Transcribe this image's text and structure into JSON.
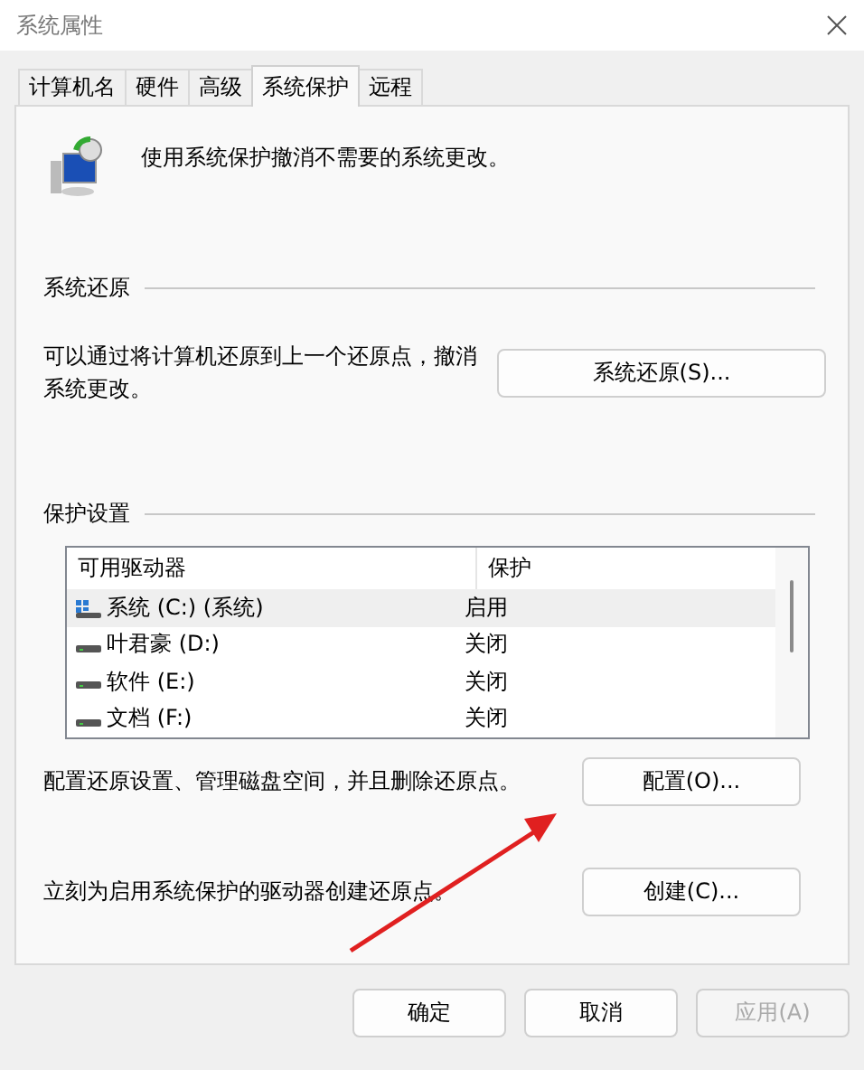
{
  "window": {
    "title": "系统属性"
  },
  "tabs": [
    {
      "label": "计算机名",
      "selected": false
    },
    {
      "label": "硬件",
      "selected": false
    },
    {
      "label": "高级",
      "selected": false
    },
    {
      "label": "系统保护",
      "selected": true
    },
    {
      "label": "远程",
      "selected": false
    }
  ],
  "intro": "使用系统保护撤消不需要的系统更改。",
  "restore": {
    "heading": "系统还原",
    "text": "可以通过将计算机还原到上一个还原点，撤消系统更改。",
    "button": "系统还原(S)..."
  },
  "protection": {
    "heading": "保护设置",
    "columns": [
      "可用驱动器",
      "保护"
    ],
    "rows": [
      {
        "kind": "system",
        "name": "系统 (C:) (系统)",
        "protection": "启用",
        "selected": true
      },
      {
        "kind": "drive",
        "name": "叶君豪 (D:)",
        "protection": "关闭",
        "selected": false
      },
      {
        "kind": "drive",
        "name": "软件 (E:)",
        "protection": "关闭",
        "selected": false
      },
      {
        "kind": "drive",
        "name": "文档 (F:)",
        "protection": "关闭",
        "selected": false
      }
    ],
    "configure_text": "配置还原设置、管理磁盘空间，并且删除还原点。",
    "configure_button": "配置(O)...",
    "create_text": "立刻为启用系统保护的驱动器创建还原点。",
    "create_button": "创建(C)..."
  },
  "buttons": [
    {
      "label": "确定",
      "disabled": false
    },
    {
      "label": "取消",
      "disabled": false
    },
    {
      "label": "应用(A)",
      "disabled": true
    }
  ]
}
